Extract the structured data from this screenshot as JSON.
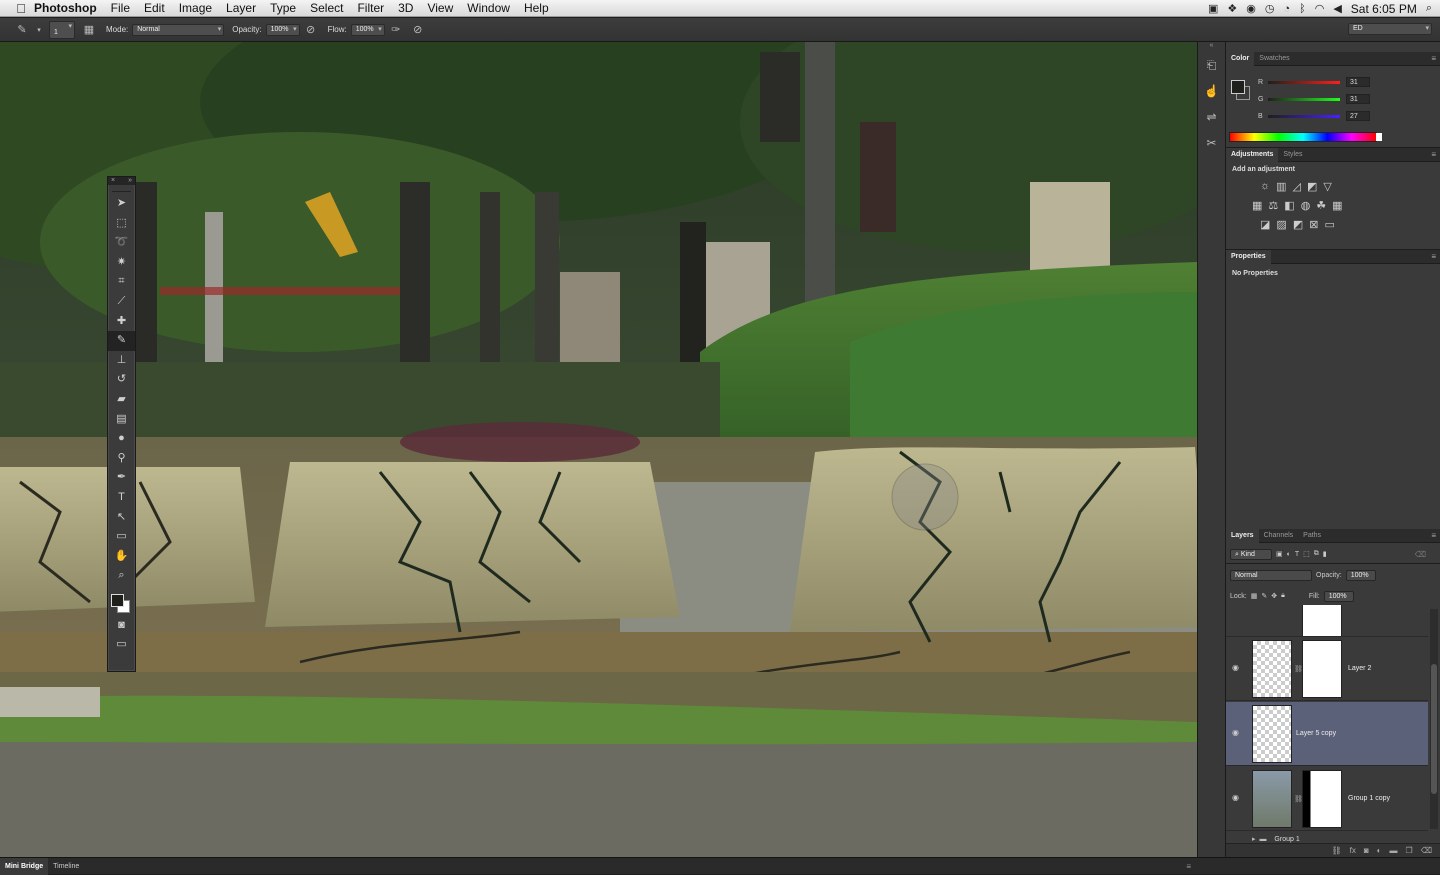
{
  "menubar": {
    "apple": "",
    "app_name": "Photoshop",
    "items": [
      "File",
      "Edit",
      "Image",
      "Layer",
      "Type",
      "Select",
      "Filter",
      "3D",
      "View",
      "Window",
      "Help"
    ],
    "clock": "Sat 6:05 PM"
  },
  "options": {
    "brush_size": "1",
    "mode_label": "Mode:",
    "mode_value": "Normal",
    "opacity_label": "Opacity:",
    "opacity_value": "100%",
    "flow_label": "Flow:",
    "flow_value": "100%",
    "workspace": "ED"
  },
  "color_panel": {
    "tabs": [
      "Color",
      "Swatches"
    ],
    "r_label": "R",
    "r_value": "31",
    "g_label": "G",
    "g_value": "31",
    "b_label": "B",
    "b_value": "27",
    "foreground": "#1f1f1b"
  },
  "adjustments_panel": {
    "tabs": [
      "Adjustments",
      "Styles"
    ],
    "title": "Add an adjustment"
  },
  "properties_panel": {
    "tab": "Properties",
    "message": "No Properties"
  },
  "layers_panel": {
    "tabs": [
      "Layers",
      "Channels",
      "Paths"
    ],
    "kind_label": "Kind",
    "blend_mode": "Normal",
    "opacity_label": "Opacity:",
    "opacity_value": "100%",
    "lock_label": "Lock:",
    "fill_label": "Fill:",
    "fill_value": "100%",
    "layers": [
      {
        "name": "Layer 2",
        "selected": false
      },
      {
        "name": "Layer 5 copy",
        "selected": true
      },
      {
        "name": "Group 1 copy",
        "selected": false
      }
    ],
    "group_name": "Group 1"
  },
  "bottom": {
    "tabs": [
      "Mini Bridge",
      "Timeline"
    ]
  },
  "colors": {
    "selection": "#5b6178",
    "panel_bg": "#3a3a3a"
  }
}
